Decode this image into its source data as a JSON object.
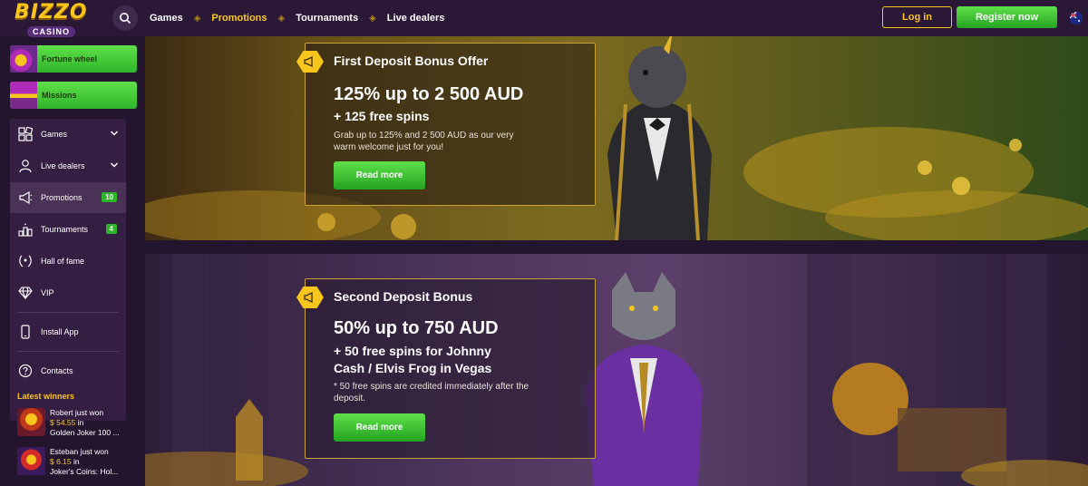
{
  "header": {
    "logo_top": "BIZZO",
    "logo_bottom": "CASINO",
    "nav": [
      {
        "label": "Games",
        "active": false
      },
      {
        "label": "Promotions",
        "active": true
      },
      {
        "label": "Tournaments",
        "active": false
      },
      {
        "label": "Live dealers",
        "active": false
      }
    ],
    "login_label": "Log in",
    "register_label": "Register now"
  },
  "sidebar": {
    "fortune_wheel": "Fortune wheel",
    "missions": "Missions",
    "items": [
      {
        "label": "Games",
        "icon": "games-icon",
        "chevron": true
      },
      {
        "label": "Live dealers",
        "icon": "live-dealers-icon",
        "chevron": true
      },
      {
        "label": "Promotions",
        "icon": "megaphone-icon",
        "badge": "10"
      },
      {
        "label": "Tournaments",
        "icon": "tournaments-icon",
        "badge": "4"
      },
      {
        "label": "Hall of fame",
        "icon": "laurel-icon"
      },
      {
        "label": "VIP",
        "icon": "diamond-icon"
      },
      {
        "label": "Install App",
        "icon": "phone-icon"
      },
      {
        "label": "Contacts",
        "icon": "question-icon"
      }
    ],
    "winners_title": "Latest winners",
    "winners": [
      {
        "name": "Robert just won",
        "amount": "$ 54.55",
        "in": "in",
        "game": "Golden Joker 100 ..."
      },
      {
        "name": "Esteban just won",
        "amount": "$ 6.15",
        "in": "in",
        "game": "Joker's Coins: Hol..."
      }
    ]
  },
  "banners": [
    {
      "title": "First Deposit Bonus Offer",
      "headline": "125% up to 2 500 AUD",
      "sub": "+ 125 free spins",
      "desc": "Grab up to 125% and 2 500 AUD as our very warm welcome just for you!",
      "button": "Read more"
    },
    {
      "title": "Second Deposit Bonus",
      "headline": "50% up to 750 AUD",
      "sub_line1": "+ 50 free spins for Johnny",
      "sub_line2": "Cash  /  Elvis Frog in Vegas",
      "desc": "* 50 free spins are credited immediately after the deposit.",
      "button": "Read more"
    }
  ],
  "colors": {
    "accent": "#f7c51c",
    "green": "#2eb32a",
    "bg": "#24152f"
  }
}
